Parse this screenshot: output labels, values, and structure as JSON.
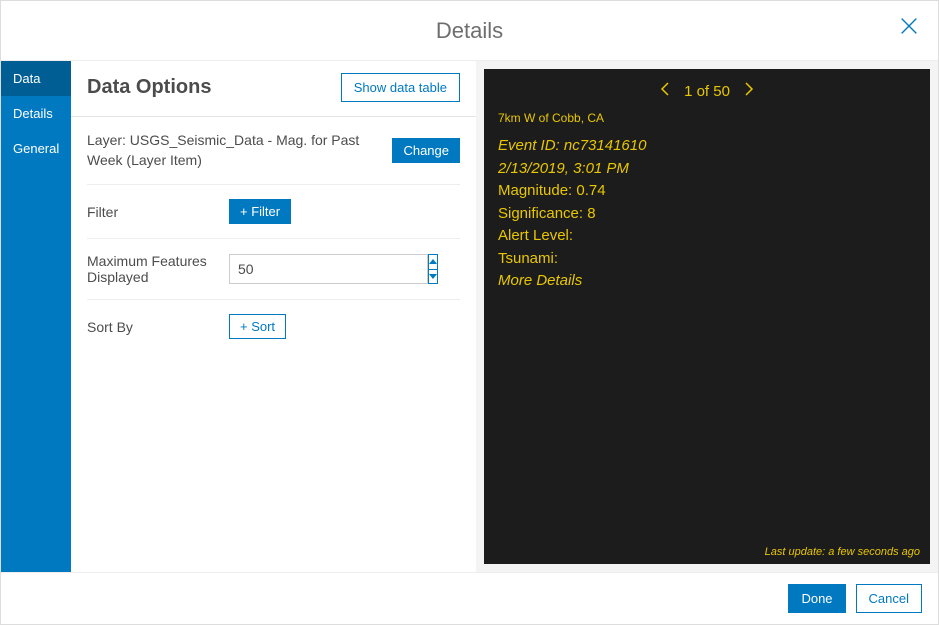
{
  "modal_title": "Details",
  "sidebar": {
    "tabs": [
      {
        "label": "Data",
        "active": true
      },
      {
        "label": "Details",
        "active": false
      },
      {
        "label": "General",
        "active": false
      }
    ]
  },
  "panel": {
    "title": "Data Options",
    "show_table_label": "Show data table",
    "layer_text": "Layer: USGS_Seismic_Data - Mag. for Past Week (Layer Item)",
    "change_label": "Change",
    "filter_label": "Filter",
    "add_filter_label": "+ Filter",
    "max_features_label": "Maximum Features Displayed",
    "max_features_value": "50",
    "sort_label": "Sort By",
    "add_sort_label": "+ Sort"
  },
  "preview": {
    "pager_text": "1 of 50",
    "title": "7km W of Cobb, CA",
    "lines": [
      {
        "text": "Event ID: nc73141610",
        "italic": true
      },
      {
        "text": "2/13/2019, 3:01 PM",
        "italic": true
      },
      {
        "text": "Magnitude: 0.74",
        "italic": false
      },
      {
        "text": "Significance: 8",
        "italic": false
      },
      {
        "text": "Alert Level:",
        "italic": false
      },
      {
        "text": "Tsunami:",
        "italic": false
      },
      {
        "text": "More Details",
        "italic": true
      }
    ],
    "footer": "Last update: a few seconds ago"
  },
  "footer": {
    "done": "Done",
    "cancel": "Cancel"
  }
}
